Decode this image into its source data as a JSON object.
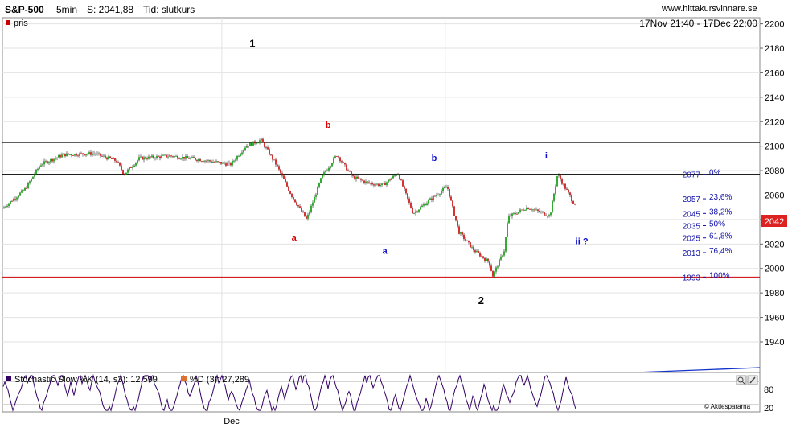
{
  "header": {
    "symbol": "S&P-500",
    "interval": "5min",
    "last_label": "S: 2041,88",
    "time_label": "Tid: slutkurs",
    "site": "www.hittakursvinnare.se",
    "range": "17Nov 21:40 - 17Dec 22:00"
  },
  "main_panel": {
    "legend_label": "pris",
    "price_badge": "2042",
    "x_tick": "Dec"
  },
  "oscillator": {
    "legend_k": "Stochastic Slow %K (14, s3): 12,599",
    "legend_d": "%D (3): 27,289",
    "credit": "© Aktiespararna",
    "y_ticks": [
      "80",
      "20"
    ]
  },
  "colors": {
    "up": "#009900",
    "down": "#cc0000",
    "wave_red": "#dd0000",
    "wave_blue": "#1111cc",
    "stoch_k": "#330066",
    "badge": "#dd2222"
  },
  "chart_data": {
    "type": "candlestick",
    "ylim": [
      1915,
      2205
    ],
    "y_ticks": [
      1940,
      1960,
      1980,
      2000,
      2020,
      2040,
      2060,
      2080,
      2100,
      2120,
      2140,
      2160,
      2180,
      2200
    ],
    "x_ticks": [
      "Dec"
    ],
    "price_path": [
      [
        0,
        2049
      ],
      [
        0.03,
        2065
      ],
      [
        0.05,
        2085
      ],
      [
        0.08,
        2093
      ],
      [
        0.12,
        2094
      ],
      [
        0.15,
        2088
      ],
      [
        0.16,
        2077
      ],
      [
        0.18,
        2090
      ],
      [
        0.22,
        2092
      ],
      [
        0.26,
        2089
      ],
      [
        0.3,
        2085
      ],
      [
        0.32,
        2100
      ],
      [
        0.34,
        2105
      ],
      [
        0.36,
        2085
      ],
      [
        0.38,
        2060
      ],
      [
        0.4,
        2040
      ],
      [
        0.42,
        2075
      ],
      [
        0.44,
        2093
      ],
      [
        0.46,
        2075
      ],
      [
        0.48,
        2070
      ],
      [
        0.5,
        2068
      ],
      [
        0.52,
        2078
      ],
      [
        0.54,
        2045
      ],
      [
        0.56,
        2055
      ],
      [
        0.585,
        2067
      ],
      [
        0.6,
        2030
      ],
      [
        0.62,
        2015
      ],
      [
        0.64,
        2005
      ],
      [
        0.645,
        1994
      ],
      [
        0.66,
        2015
      ],
      [
        0.665,
        2042
      ],
      [
        0.69,
        2050
      ],
      [
        0.72,
        2043
      ],
      [
        0.73,
        2077
      ],
      [
        0.75,
        2055
      ],
      [
        0.77,
        2041
      ]
    ],
    "reference_lines": [
      {
        "value": 2103,
        "color": "#000000"
      },
      {
        "value": 2077,
        "color": "#000000"
      },
      {
        "value": 1993,
        "color": "#cc0000"
      }
    ],
    "fibonacci": [
      {
        "price": "2077",
        "pct": "0%",
        "value": 2077
      },
      {
        "price": "2057",
        "pct": "23,6%",
        "value": 2057
      },
      {
        "price": "2045",
        "pct": "38,2%",
        "value": 2045
      },
      {
        "price": "2035",
        "pct": "50%",
        "value": 2035
      },
      {
        "price": "2025",
        "pct": "61,8%",
        "value": 2025
      },
      {
        "price": "2013",
        "pct": "76,4%",
        "value": 2013
      },
      {
        "price": "1993",
        "pct": "100%",
        "value": 1993
      }
    ],
    "wave_labels": [
      {
        "text": "1",
        "color": "black",
        "value": 2181,
        "xf": 0.33
      },
      {
        "text": "b",
        "color": "red",
        "value": 2115,
        "xf": 0.43
      },
      {
        "text": "a",
        "color": "red",
        "value": 2023,
        "xf": 0.385
      },
      {
        "text": "b",
        "color": "blue",
        "value": 2088,
        "xf": 0.57
      },
      {
        "text": "a",
        "color": "blue",
        "value": 2012,
        "xf": 0.505
      },
      {
        "text": "2",
        "color": "black",
        "value": 1971,
        "xf": 0.632
      },
      {
        "text": "i",
        "color": "blue",
        "value": 2090,
        "xf": 0.718
      },
      {
        "text": "ii ?",
        "color": "blue",
        "value": 2020,
        "xf": 0.765
      }
    ]
  }
}
